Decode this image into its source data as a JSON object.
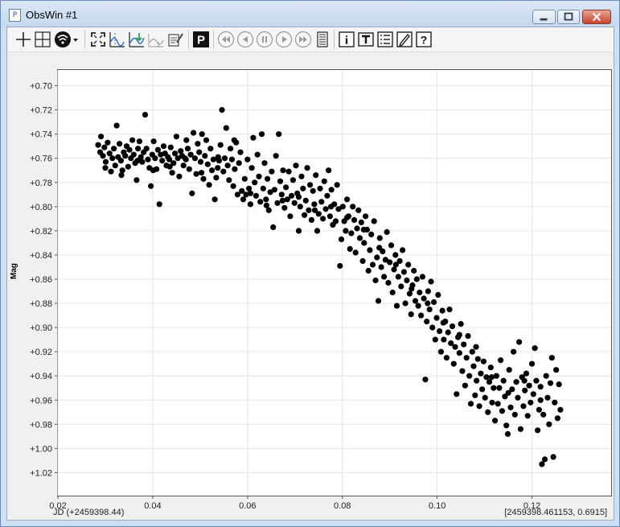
{
  "window": {
    "title": "ObsWin #1",
    "app_icon_letter": "P"
  },
  "toolbar": {
    "groups": [
      [
        "crosshair-icon",
        "crosshair-box-icon",
        "signal-dropdown-icon"
      ],
      [
        "zoom-fit-icon",
        "fold-period-icon",
        "model-fit-icon",
        "residuals-icon",
        "clipboard-list-icon"
      ],
      [
        "phase-plot-icon"
      ],
      [
        "first-icon",
        "prev-icon",
        "pause-icon",
        "play-icon",
        "last-icon",
        "list-icon"
      ],
      [
        "info-icon",
        "text-tool-icon",
        "list-detail-icon",
        "edit-icon",
        "help-icon"
      ]
    ],
    "phase_label": "P",
    "info_label": "i",
    "help_label": "?"
  },
  "plot": {
    "ylabel": "Mag",
    "x_footer": "JD (+2459398.44)",
    "cursor_readout": "[2459398.461153, 0.6915]"
  },
  "chart_data": {
    "type": "scatter",
    "xlabel": "JD (+2459398.44)",
    "ylabel": "Mag",
    "xlim": [
      0.02,
      0.1367
    ],
    "ylim": [
      0.687,
      1.039
    ],
    "y_inverted": true,
    "grid": true,
    "x_ticks": [
      "0.02",
      "0.04",
      "0.06",
      "0.08",
      "0.10",
      "0.12"
    ],
    "y_ticks": [
      "+0.70",
      "+0.72",
      "+0.74",
      "+0.76",
      "+0.78",
      "+0.80",
      "+0.82",
      "+0.84",
      "+0.86",
      "+0.88",
      "+0.90",
      "+0.92",
      "+0.94",
      "+0.96",
      "+0.98",
      "+1.00",
      "+1.02"
    ],
    "marker_color": "#000000",
    "points": [
      [
        0.0285,
        0.749
      ],
      [
        0.0289,
        0.755
      ],
      [
        0.0291,
        0.742
      ],
      [
        0.0295,
        0.758
      ],
      [
        0.0298,
        0.751
      ],
      [
        0.0301,
        0.763
      ],
      [
        0.0305,
        0.747
      ],
      [
        0.0309,
        0.756
      ],
      [
        0.0312,
        0.771
      ],
      [
        0.0315,
        0.76
      ],
      [
        0.0318,
        0.752
      ],
      [
        0.0321,
        0.766
      ],
      [
        0.0324,
        0.733
      ],
      [
        0.0327,
        0.759
      ],
      [
        0.033,
        0.748
      ],
      [
        0.0333,
        0.762
      ],
      [
        0.0336,
        0.77
      ],
      [
        0.0339,
        0.755
      ],
      [
        0.0342,
        0.758
      ],
      [
        0.0345,
        0.75
      ],
      [
        0.0348,
        0.767
      ],
      [
        0.0351,
        0.753
      ],
      [
        0.0354,
        0.76
      ],
      [
        0.0357,
        0.745
      ],
      [
        0.036,
        0.757
      ],
      [
        0.0363,
        0.764
      ],
      [
        0.0366,
        0.778
      ],
      [
        0.0369,
        0.752
      ],
      [
        0.0372,
        0.746
      ],
      [
        0.0375,
        0.759
      ],
      [
        0.0378,
        0.763
      ],
      [
        0.0381,
        0.755
      ],
      [
        0.0384,
        0.724
      ],
      [
        0.0387,
        0.752
      ],
      [
        0.039,
        0.761
      ],
      [
        0.0393,
        0.768
      ],
      [
        0.0396,
        0.783
      ],
      [
        0.0399,
        0.757
      ],
      [
        0.0402,
        0.746
      ],
      [
        0.0405,
        0.76
      ],
      [
        0.0408,
        0.769
      ],
      [
        0.0411,
        0.753
      ],
      [
        0.0414,
        0.798
      ],
      [
        0.0417,
        0.757
      ],
      [
        0.042,
        0.762
      ],
      [
        0.0423,
        0.75
      ],
      [
        0.0426,
        0.756
      ],
      [
        0.0429,
        0.766
      ],
      [
        0.0432,
        0.759
      ],
      [
        0.0435,
        0.761
      ],
      [
        0.0438,
        0.751
      ],
      [
        0.0441,
        0.772
      ],
      [
        0.0444,
        0.764
      ],
      [
        0.0447,
        0.756
      ],
      [
        0.045,
        0.742
      ],
      [
        0.0453,
        0.76
      ],
      [
        0.0456,
        0.775
      ],
      [
        0.0459,
        0.754
      ],
      [
        0.0462,
        0.758
      ],
      [
        0.0465,
        0.766
      ],
      [
        0.0468,
        0.76
      ],
      [
        0.0471,
        0.745
      ],
      [
        0.0474,
        0.752
      ],
      [
        0.0477,
        0.769
      ],
      [
        0.048,
        0.757
      ],
      [
        0.0483,
        0.789
      ],
      [
        0.0486,
        0.739
      ],
      [
        0.0489,
        0.76
      ],
      [
        0.0492,
        0.773
      ],
      [
        0.0495,
        0.748
      ],
      [
        0.0498,
        0.755
      ],
      [
        0.0501,
        0.763
      ],
      [
        0.0504,
        0.74
      ],
      [
        0.0507,
        0.777
      ],
      [
        0.051,
        0.758
      ],
      [
        0.0513,
        0.745
      ],
      [
        0.0516,
        0.765
      ],
      [
        0.0519,
        0.782
      ],
      [
        0.0522,
        0.752
      ],
      [
        0.0525,
        0.77
      ],
      [
        0.0528,
        0.761
      ],
      [
        0.0531,
        0.794
      ],
      [
        0.0534,
        0.776
      ],
      [
        0.0537,
        0.768
      ],
      [
        0.054,
        0.762
      ],
      [
        0.0543,
        0.749
      ],
      [
        0.0546,
        0.72
      ],
      [
        0.0549,
        0.771
      ],
      [
        0.0552,
        0.76
      ],
      [
        0.0555,
        0.735
      ],
      [
        0.0558,
        0.766
      ],
      [
        0.0561,
        0.778
      ],
      [
        0.0564,
        0.752
      ],
      [
        0.0567,
        0.761
      ],
      [
        0.057,
        0.783
      ],
      [
        0.0573,
        0.769
      ],
      [
        0.0576,
        0.747
      ],
      [
        0.0579,
        0.79
      ],
      [
        0.0582,
        0.764
      ],
      [
        0.0585,
        0.755
      ],
      [
        0.0588,
        0.787
      ],
      [
        0.0591,
        0.794
      ],
      [
        0.0594,
        0.777
      ],
      [
        0.0597,
        0.79
      ],
      [
        0.06,
        0.761
      ],
      [
        0.0603,
        0.785
      ],
      [
        0.0606,
        0.798
      ],
      [
        0.0609,
        0.768
      ],
      [
        0.0612,
        0.743
      ],
      [
        0.0615,
        0.78
      ],
      [
        0.0618,
        0.791
      ],
      [
        0.0621,
        0.757
      ],
      [
        0.0624,
        0.775
      ],
      [
        0.0627,
        0.796
      ],
      [
        0.063,
        0.74
      ],
      [
        0.0633,
        0.785
      ],
      [
        0.0636,
        0.764
      ],
      [
        0.0639,
        0.794
      ],
      [
        0.0642,
        0.777
      ],
      [
        0.0645,
        0.803
      ],
      [
        0.0648,
        0.788
      ],
      [
        0.0651,
        0.771
      ],
      [
        0.0654,
        0.817
      ],
      [
        0.0657,
        0.786
      ],
      [
        0.066,
        0.758
      ],
      [
        0.0663,
        0.797
      ],
      [
        0.0666,
        0.74
      ],
      [
        0.0669,
        0.779
      ],
      [
        0.0672,
        0.79
      ],
      [
        0.0675,
        0.77
      ],
      [
        0.0678,
        0.801
      ],
      [
        0.0681,
        0.784
      ],
      [
        0.0684,
        0.794
      ],
      [
        0.0687,
        0.771
      ],
      [
        0.069,
        0.808
      ],
      [
        0.0693,
        0.791
      ],
      [
        0.0696,
        0.778
      ],
      [
        0.0699,
        0.797
      ],
      [
        0.0702,
        0.766
      ],
      [
        0.0705,
        0.789
      ],
      [
        0.0708,
        0.82
      ],
      [
        0.0711,
        0.8
      ],
      [
        0.0714,
        0.775
      ],
      [
        0.0717,
        0.785
      ],
      [
        0.072,
        0.807
      ],
      [
        0.0723,
        0.795
      ],
      [
        0.0726,
        0.768
      ],
      [
        0.0729,
        0.803
      ],
      [
        0.0732,
        0.782
      ],
      [
        0.0735,
        0.811
      ],
      [
        0.0738,
        0.787
      ],
      [
        0.0741,
        0.798
      ],
      [
        0.0744,
        0.774
      ],
      [
        0.0747,
        0.82
      ],
      [
        0.075,
        0.806
      ],
      [
        0.0753,
        0.785
      ],
      [
        0.0756,
        0.796
      ],
      [
        0.0759,
        0.81
      ],
      [
        0.0762,
        0.779
      ],
      [
        0.0765,
        0.802
      ],
      [
        0.0768,
        0.791
      ],
      [
        0.0771,
        0.77
      ],
      [
        0.0774,
        0.808
      ],
      [
        0.0777,
        0.786
      ],
      [
        0.078,
        0.815
      ],
      [
        0.0783,
        0.798
      ],
      [
        0.0786,
        0.812
      ],
      [
        0.0789,
        0.782
      ],
      [
        0.0792,
        0.802
      ],
      [
        0.0795,
        0.849
      ],
      [
        0.0798,
        0.827
      ],
      [
        0.0801,
        0.8
      ],
      [
        0.0804,
        0.812
      ],
      [
        0.0807,
        0.82
      ],
      [
        0.081,
        0.794
      ],
      [
        0.0813,
        0.808
      ],
      [
        0.0816,
        0.835
      ],
      [
        0.0819,
        0.822
      ],
      [
        0.0822,
        0.8
      ],
      [
        0.0825,
        0.811
      ],
      [
        0.0828,
        0.838
      ],
      [
        0.0831,
        0.818
      ],
      [
        0.0834,
        0.803
      ],
      [
        0.0837,
        0.826
      ],
      [
        0.084,
        0.813
      ],
      [
        0.0843,
        0.845
      ],
      [
        0.0846,
        0.83
      ],
      [
        0.0849,
        0.808
      ],
      [
        0.0852,
        0.819
      ],
      [
        0.0855,
        0.853
      ],
      [
        0.0858,
        0.836
      ],
      [
        0.0861,
        0.823
      ],
      [
        0.0864,
        0.848
      ],
      [
        0.0867,
        0.812
      ],
      [
        0.087,
        0.861
      ],
      [
        0.0873,
        0.842
      ],
      [
        0.0876,
        0.878
      ],
      [
        0.0879,
        0.826
      ],
      [
        0.0882,
        0.85
      ],
      [
        0.0885,
        0.837
      ],
      [
        0.0888,
        0.858
      ],
      [
        0.0891,
        0.844
      ],
      [
        0.0894,
        0.821
      ],
      [
        0.0897,
        0.863
      ],
      [
        0.09,
        0.846
      ],
      [
        0.0903,
        0.832
      ],
      [
        0.0906,
        0.871
      ],
      [
        0.0909,
        0.852
      ],
      [
        0.0912,
        0.84
      ],
      [
        0.0915,
        0.882
      ],
      [
        0.0918,
        0.858
      ],
      [
        0.0921,
        0.845
      ],
      [
        0.0924,
        0.866
      ],
      [
        0.0927,
        0.836
      ],
      [
        0.093,
        0.854
      ],
      [
        0.0933,
        0.88
      ],
      [
        0.0936,
        0.861
      ],
      [
        0.0939,
        0.848
      ],
      [
        0.0942,
        0.872
      ],
      [
        0.0945,
        0.889
      ],
      [
        0.0948,
        0.865
      ],
      [
        0.0951,
        0.853
      ],
      [
        0.0954,
        0.878
      ],
      [
        0.0957,
        0.86
      ],
      [
        0.096,
        0.882
      ],
      [
        0.0963,
        0.871
      ],
      [
        0.0966,
        0.89
      ],
      [
        0.0969,
        0.858
      ],
      [
        0.0972,
        0.876
      ],
      [
        0.0975,
        0.943
      ],
      [
        0.0978,
        0.895
      ],
      [
        0.0981,
        0.87
      ],
      [
        0.0984,
        0.885
      ],
      [
        0.0987,
        0.862
      ],
      [
        0.099,
        0.9
      ],
      [
        0.0993,
        0.879
      ],
      [
        0.0996,
        0.91
      ],
      [
        0.0999,
        0.892
      ],
      [
        0.1002,
        0.873
      ],
      [
        0.1005,
        0.903
      ],
      [
        0.1008,
        0.92
      ],
      [
        0.1011,
        0.886
      ],
      [
        0.1014,
        0.91
      ],
      [
        0.1017,
        0.895
      ],
      [
        0.102,
        0.925
      ],
      [
        0.1023,
        0.904
      ],
      [
        0.1026,
        0.885
      ],
      [
        0.1029,
        0.913
      ],
      [
        0.1032,
        0.899
      ],
      [
        0.1035,
        0.93
      ],
      [
        0.1038,
        0.916
      ],
      [
        0.1041,
        0.955
      ],
      [
        0.1044,
        0.908
      ],
      [
        0.1047,
        0.921
      ],
      [
        0.105,
        0.897
      ],
      [
        0.1053,
        0.936
      ],
      [
        0.1056,
        0.914
      ],
      [
        0.1059,
        0.948
      ],
      [
        0.1062,
        0.925
      ],
      [
        0.1065,
        0.907
      ],
      [
        0.1068,
        0.94
      ],
      [
        0.1071,
        0.963
      ],
      [
        0.1074,
        0.92
      ],
      [
        0.1077,
        0.932
      ],
      [
        0.108,
        0.956
      ],
      [
        0.1083,
        0.944
      ],
      [
        0.1086,
        0.926
      ],
      [
        0.1089,
        0.965
      ],
      [
        0.1092,
        0.938
      ],
      [
        0.1095,
        0.951
      ],
      [
        0.1098,
        0.928
      ],
      [
        0.1101,
        0.958
      ],
      [
        0.1104,
        0.941
      ],
      [
        0.1107,
        0.97
      ],
      [
        0.111,
        0.945
      ],
      [
        0.1113,
        0.933
      ],
      [
        0.1116,
        0.962
      ],
      [
        0.1119,
        0.95
      ],
      [
        0.1122,
        0.977
      ],
      [
        0.1125,
        0.94
      ],
      [
        0.1128,
        0.963
      ],
      [
        0.1131,
        0.95
      ],
      [
        0.1134,
        0.927
      ],
      [
        0.1137,
        0.969
      ],
      [
        0.114,
        0.944
      ],
      [
        0.1143,
        0.957
      ],
      [
        0.1146,
        0.981
      ],
      [
        0.1149,
        0.988
      ],
      [
        0.1152,
        0.935
      ],
      [
        0.1155,
        0.966
      ],
      [
        0.1158,
        0.951
      ],
      [
        0.1161,
        0.92
      ],
      [
        0.1164,
        0.972
      ],
      [
        0.1167,
        0.945
      ],
      [
        0.117,
        0.958
      ],
      [
        0.1173,
        0.912
      ],
      [
        0.1176,
        0.984
      ],
      [
        0.1179,
        0.941
      ],
      [
        0.1182,
        0.965
      ],
      [
        0.1185,
        0.952
      ],
      [
        0.1188,
        0.938
      ],
      [
        0.1191,
        0.973
      ],
      [
        0.1194,
        0.948
      ],
      [
        0.1197,
        0.962
      ],
      [
        0.12,
        0.93
      ],
      [
        0.1203,
        0.955
      ],
      [
        0.1206,
        0.917
      ],
      [
        0.1209,
        0.944
      ],
      [
        0.1212,
        0.985
      ],
      [
        0.1215,
        0.968
      ],
      [
        0.1218,
        0.949
      ],
      [
        0.1221,
        1.013
      ],
      [
        0.1224,
        0.972
      ],
      [
        0.1227,
        1.009
      ],
      [
        0.123,
        0.94
      ],
      [
        0.1233,
        0.958
      ],
      [
        0.1236,
        0.98
      ],
      [
        0.1239,
        0.946
      ],
      [
        0.1242,
        0.925
      ],
      [
        0.1245,
        1.007
      ],
      [
        0.1248,
        0.962
      ],
      [
        0.1251,
        0.935
      ],
      [
        0.1254,
        0.975
      ],
      [
        0.1257,
        0.947
      ],
      [
        0.126,
        0.968
      ],
      [
        0.03,
        0.768
      ],
      [
        0.0334,
        0.774
      ],
      [
        0.0368,
        0.762
      ],
      [
        0.0401,
        0.77
      ],
      [
        0.0436,
        0.767
      ],
      [
        0.047,
        0.761
      ],
      [
        0.0503,
        0.772
      ],
      [
        0.0538,
        0.759
      ],
      [
        0.0572,
        0.745
      ],
      [
        0.0606,
        0.789
      ],
      [
        0.064,
        0.799
      ],
      [
        0.0674,
        0.795
      ],
      [
        0.0708,
        0.792
      ],
      [
        0.0742,
        0.803
      ],
      [
        0.0776,
        0.8
      ],
      [
        0.081,
        0.809
      ],
      [
        0.0845,
        0.819
      ],
      [
        0.0878,
        0.834
      ],
      [
        0.0913,
        0.848
      ],
      [
        0.0946,
        0.868
      ],
      [
        0.098,
        0.88
      ],
      [
        0.1013,
        0.896
      ],
      [
        0.1047,
        0.906
      ],
      [
        0.1082,
        0.916
      ],
      [
        0.1115,
        0.941
      ],
      [
        0.115,
        0.954
      ],
      [
        0.1184,
        0.944
      ],
      [
        0.1218,
        0.96
      ]
    ]
  }
}
